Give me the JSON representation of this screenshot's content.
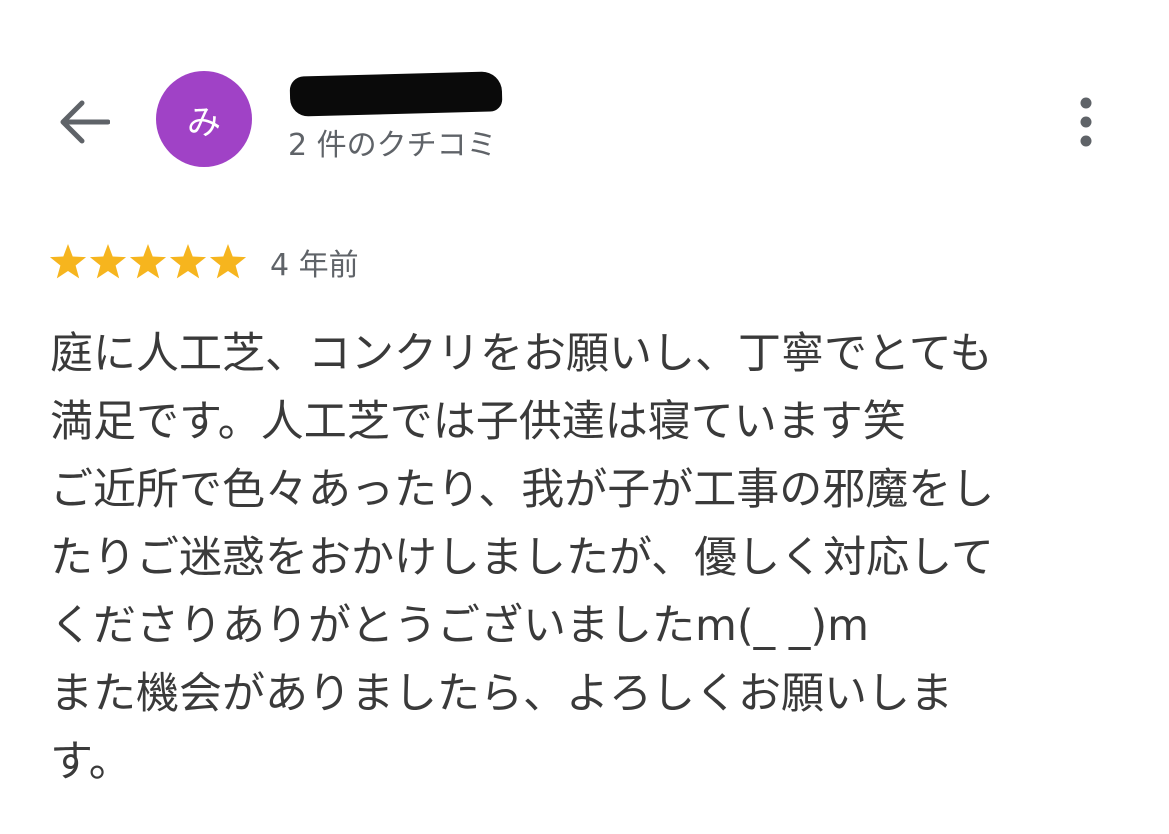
{
  "header": {
    "back_icon": "arrow-left-icon",
    "avatar_initial": "み",
    "avatar_color": "#a042c6",
    "reviewer_name_redacted": true,
    "review_count": "2 件のクチコミ",
    "more_icon": "more-vert-icon"
  },
  "review": {
    "rating": 5,
    "rating_max": 5,
    "star_color": "#f6b51e",
    "time_ago": "4 年前",
    "lines": [
      "庭に人工芝、コンクリをお願いし、丁寧でとても",
      "満足です。人工芝では子供達は寝ています笑",
      "ご近所で色々あったり、我が子が工事の邪魔をし",
      "たりご迷惑をおかけしましたが、優しく対応して",
      "くださりありがとうございましたm(_ _)m",
      "また機会がありましたら、よろしくお願いしま",
      "す。"
    ]
  }
}
